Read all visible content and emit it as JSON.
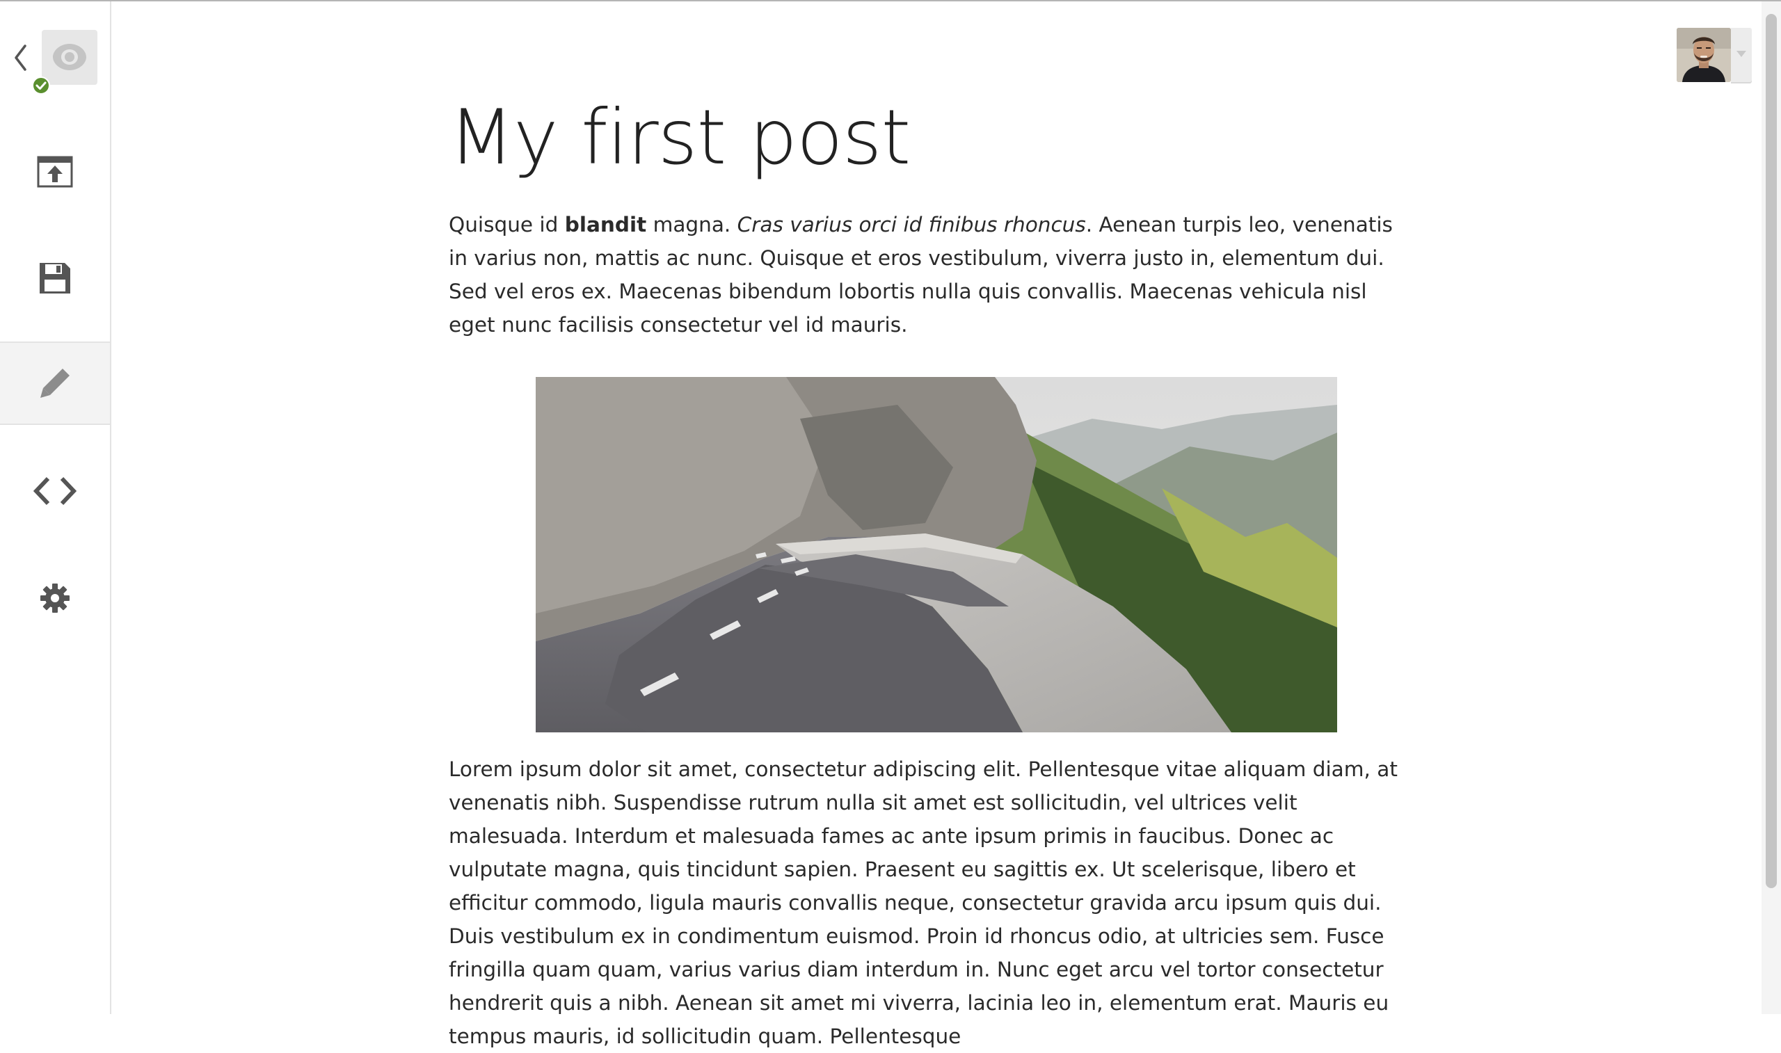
{
  "post": {
    "title": "My first post",
    "paragraph1": {
      "t1": "Quisque id ",
      "bold": "blandit",
      "t2": " magna. ",
      "italic": "Cras varius orci id finibus rhoncus",
      "t3": ". Aenean turpis leo, venenatis in varius non, mattis ac nunc. Quisque et eros vestibulum, viverra justo in, elementum dui. Sed vel eros ex. Maecenas bibendum lobortis nulla quis convallis. Maecenas vehicula nisl eget nunc facilisis consectetur vel id mauris."
    },
    "paragraph2": "Lorem ipsum dolor sit amet, consectetur adipiscing elit. Pellentesque vitae aliquam diam, at venenatis nibh. Suspendisse rutrum nulla sit amet est sollicitudin, vel ultrices velit malesuada. Interdum et malesuada fames ac ante ipsum primis in faucibus. Donec ac vulputate magna, quis tincidunt sapien. Praesent eu sagittis ex. Ut scelerisque, libero et efficitur commodo, ligula mauris convallis neque, consectetur gravida arcu ipsum quis dui. Duis vestibulum ex in condimentum euismod. Proin id rhoncus odio, at ultricies sem. Fusce fringilla quam quam, varius varius diam interdum in. Nunc eget arcu vel tortor consectetur hendrerit quis a nibh. Aenean sit amet mi viverra, lacinia leo in, elementum erat. Mauris eu tempus mauris, id sollicitudin quam. Pellentesque"
  },
  "sidebar": {
    "icons": [
      "chevron-left-icon",
      "logo-icon",
      "check-icon",
      "publish-icon",
      "save-icon",
      "pencil-icon",
      "code-icon",
      "gear-icon"
    ],
    "active_item": "edit"
  },
  "image": {
    "subject": "mountain road"
  },
  "colors": {
    "sidebar_icon": "#555555",
    "logo_tile": "#e7e7e7",
    "status_green": "#5a8f2e",
    "active_bg": "#f3f3f3"
  }
}
